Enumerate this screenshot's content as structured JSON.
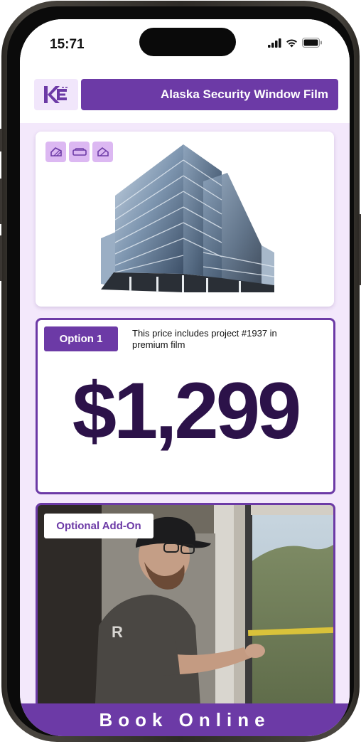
{
  "status_bar": {
    "time": "15:71"
  },
  "header": {
    "title": "Alaska Security Window Film",
    "logo_alt": "KE"
  },
  "building_card": {
    "tools": [
      "tint-icon",
      "film-icon",
      "shade-icon"
    ]
  },
  "price_card": {
    "option_label": "Option 1",
    "note": "This price includes project #1937 in premium film",
    "price": "$1,299"
  },
  "addon_card": {
    "label": "Optional Add-On"
  },
  "footer": {
    "book_label": "Book Online"
  },
  "colors": {
    "accent": "#6c3aa6",
    "price_text": "#2c1249",
    "background": "#f3e8fb"
  }
}
